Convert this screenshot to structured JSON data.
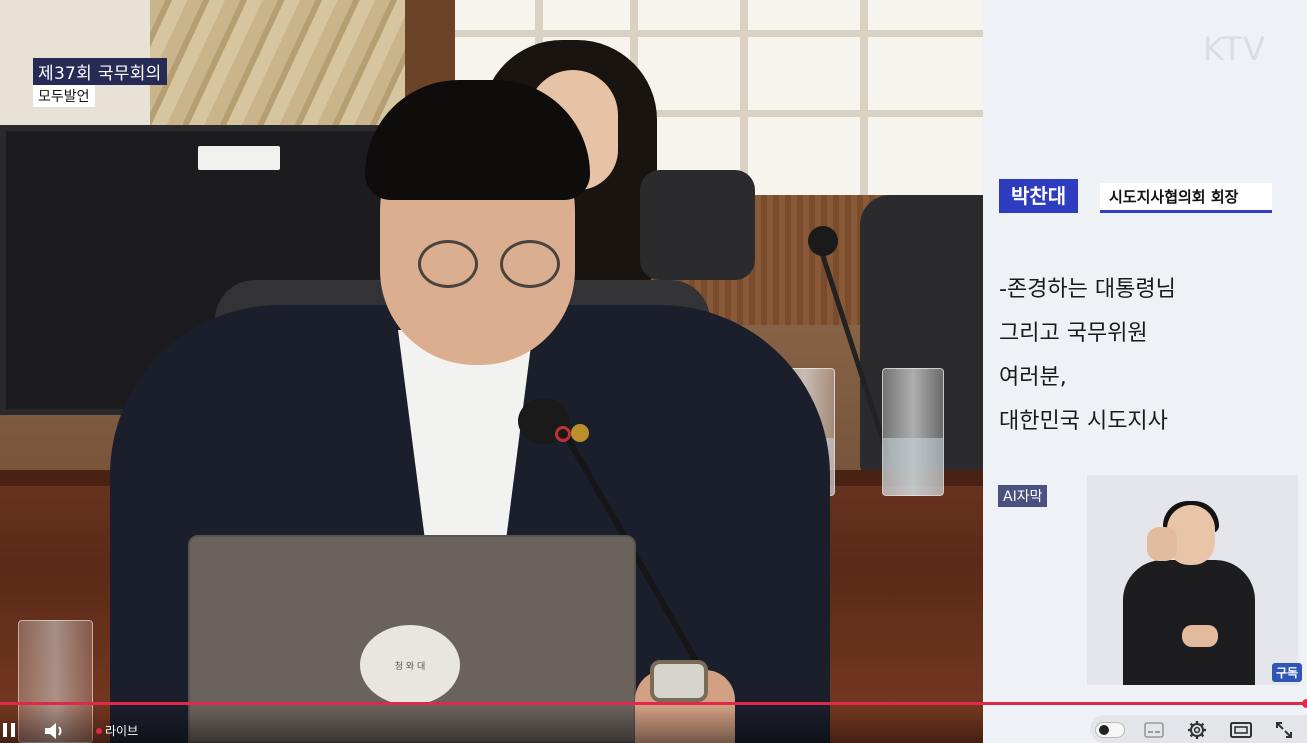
{
  "overlay": {
    "meeting_title": "제37회 국무회의",
    "meeting_subtitle": "모두발언"
  },
  "sidebar": {
    "logo": "KTV",
    "speaker_name": "박찬대",
    "speaker_role": "시도지사협의회 회장",
    "caption_lines": [
      "-존경하는 대통령님",
      "그리고 국무위원",
      "여러분,",
      "대한민국 시도지사"
    ],
    "ai_caption_tag": "AI자막",
    "subscribe_label": "구독"
  },
  "player": {
    "live_label": "라이브",
    "progress": 1.0,
    "accent_color": "#e0294a",
    "icons": [
      "pause-icon",
      "volume-icon",
      "subtitles-toggle-icon",
      "captions-icon",
      "settings-icon",
      "theater-mode-icon",
      "fullscreen-icon"
    ]
  },
  "colors": {
    "name_box": "#2e3cbf",
    "title_box": "#252b54"
  },
  "laptop_logo_text": "청 와 대"
}
